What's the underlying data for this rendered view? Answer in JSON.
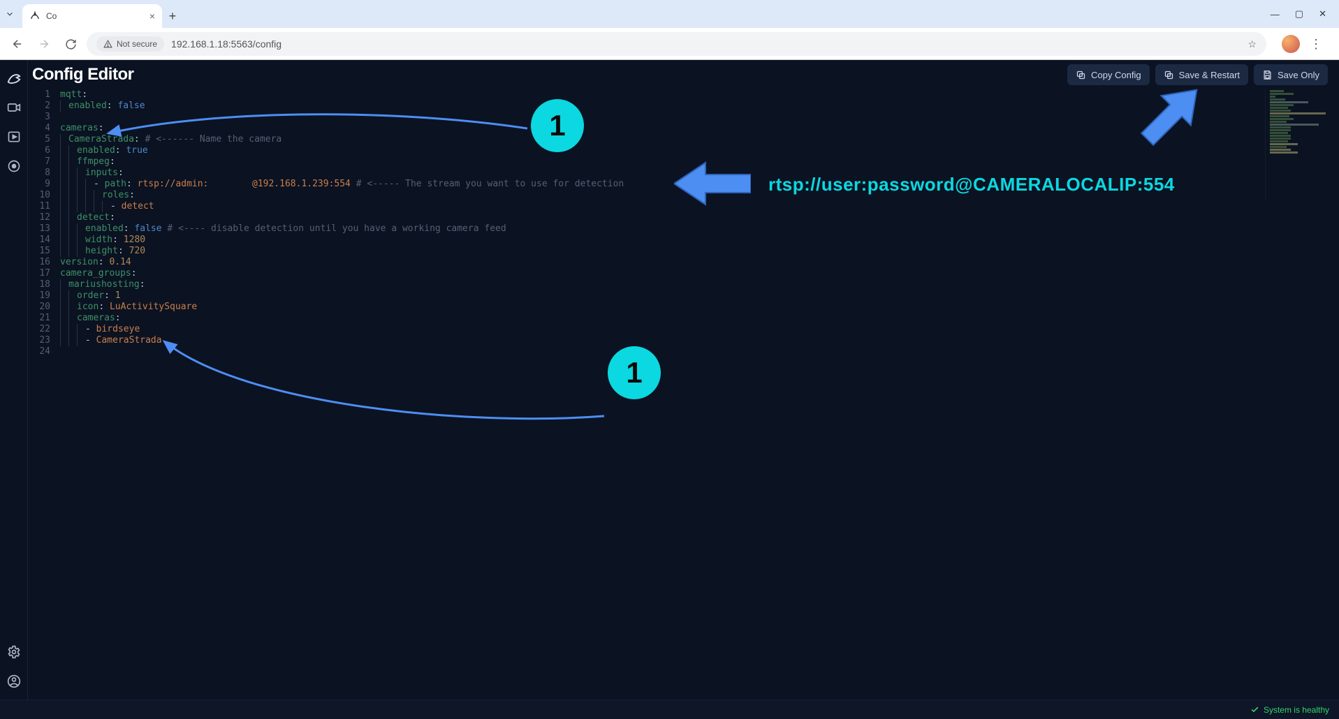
{
  "browser": {
    "tab_title": "Co",
    "url": "192.168.1.18:5563/config",
    "insecure_label": "Not secure"
  },
  "header": {
    "title": "Config Editor",
    "copy": "Copy Config",
    "save_restart": "Save & Restart",
    "save_only": "Save Only"
  },
  "status": {
    "text": "System is healthy"
  },
  "annotations": {
    "badge1": "1",
    "badge2": "1",
    "rtsp_hint": "rtsp://user:password@CAMERALOCALIP:554"
  },
  "editor": {
    "lines": [
      {
        "n": 1,
        "ind": 0,
        "seg": [
          [
            "key",
            "mqtt"
          ],
          [
            "plain",
            ":"
          ]
        ]
      },
      {
        "n": 2,
        "ind": 1,
        "seg": [
          [
            "key",
            "enabled"
          ],
          [
            "plain",
            ": "
          ],
          [
            "bool",
            "false"
          ]
        ]
      },
      {
        "n": 3,
        "ind": 0,
        "seg": [
          [
            "plain",
            ""
          ]
        ]
      },
      {
        "n": 4,
        "ind": 0,
        "seg": [
          [
            "key",
            "cameras"
          ],
          [
            "plain",
            ":"
          ]
        ]
      },
      {
        "n": 5,
        "ind": 1,
        "seg": [
          [
            "key",
            "CameraStrada"
          ],
          [
            "plain",
            ": "
          ],
          [
            "comm",
            "# <------ Name the camera"
          ]
        ]
      },
      {
        "n": 6,
        "ind": 2,
        "seg": [
          [
            "key",
            "enabled"
          ],
          [
            "plain",
            ": "
          ],
          [
            "bool",
            "true"
          ]
        ]
      },
      {
        "n": 7,
        "ind": 2,
        "seg": [
          [
            "key",
            "ffmpeg"
          ],
          [
            "plain",
            ":"
          ]
        ]
      },
      {
        "n": 8,
        "ind": 3,
        "seg": [
          [
            "key",
            "inputs"
          ],
          [
            "plain",
            ":"
          ]
        ]
      },
      {
        "n": 9,
        "ind": 4,
        "seg": [
          [
            "dash",
            "- "
          ],
          [
            "key",
            "path"
          ],
          [
            "plain",
            ": "
          ],
          [
            "str",
            "rtsp://admin:"
          ],
          [
            "plain",
            "        "
          ],
          [
            "str",
            "@192.168.1.239:554"
          ],
          [
            "plain",
            " "
          ],
          [
            "comm",
            "# <----- The stream you want to use for detection"
          ]
        ]
      },
      {
        "n": 10,
        "ind": 5,
        "seg": [
          [
            "key",
            "roles"
          ],
          [
            "plain",
            ":"
          ]
        ]
      },
      {
        "n": 11,
        "ind": 6,
        "seg": [
          [
            "dash",
            "- "
          ],
          [
            "str",
            "detect"
          ]
        ]
      },
      {
        "n": 12,
        "ind": 2,
        "seg": [
          [
            "key",
            "detect"
          ],
          [
            "plain",
            ":"
          ]
        ]
      },
      {
        "n": 13,
        "ind": 3,
        "seg": [
          [
            "key",
            "enabled"
          ],
          [
            "plain",
            ": "
          ],
          [
            "bool",
            "false"
          ],
          [
            "plain",
            " "
          ],
          [
            "comm",
            "# <---- disable detection until you have a working camera feed"
          ]
        ]
      },
      {
        "n": 14,
        "ind": 3,
        "seg": [
          [
            "key",
            "width"
          ],
          [
            "plain",
            ": "
          ],
          [
            "num",
            "1280"
          ]
        ]
      },
      {
        "n": 15,
        "ind": 3,
        "seg": [
          [
            "key",
            "height"
          ],
          [
            "plain",
            ": "
          ],
          [
            "num",
            "720"
          ]
        ]
      },
      {
        "n": 16,
        "ind": 0,
        "seg": [
          [
            "key",
            "version"
          ],
          [
            "plain",
            ": "
          ],
          [
            "num",
            "0.14"
          ]
        ]
      },
      {
        "n": 17,
        "ind": 0,
        "seg": [
          [
            "key",
            "camera_groups"
          ],
          [
            "plain",
            ":"
          ]
        ]
      },
      {
        "n": 18,
        "ind": 1,
        "seg": [
          [
            "key",
            "mariushosting"
          ],
          [
            "plain",
            ":"
          ]
        ]
      },
      {
        "n": 19,
        "ind": 2,
        "seg": [
          [
            "key",
            "order"
          ],
          [
            "plain",
            ": "
          ],
          [
            "num",
            "1"
          ]
        ]
      },
      {
        "n": 20,
        "ind": 2,
        "seg": [
          [
            "key",
            "icon"
          ],
          [
            "plain",
            ": "
          ],
          [
            "str",
            "LuActivitySquare"
          ]
        ]
      },
      {
        "n": 21,
        "ind": 2,
        "seg": [
          [
            "key",
            "cameras"
          ],
          [
            "plain",
            ":"
          ]
        ]
      },
      {
        "n": 22,
        "ind": 3,
        "seg": [
          [
            "dash",
            "- "
          ],
          [
            "str",
            "birdseye"
          ]
        ]
      },
      {
        "n": 23,
        "ind": 3,
        "seg": [
          [
            "dash",
            "- "
          ],
          [
            "str",
            "CameraStrada"
          ]
        ]
      },
      {
        "n": 24,
        "ind": 0,
        "seg": [
          [
            "plain",
            ""
          ]
        ]
      }
    ]
  }
}
